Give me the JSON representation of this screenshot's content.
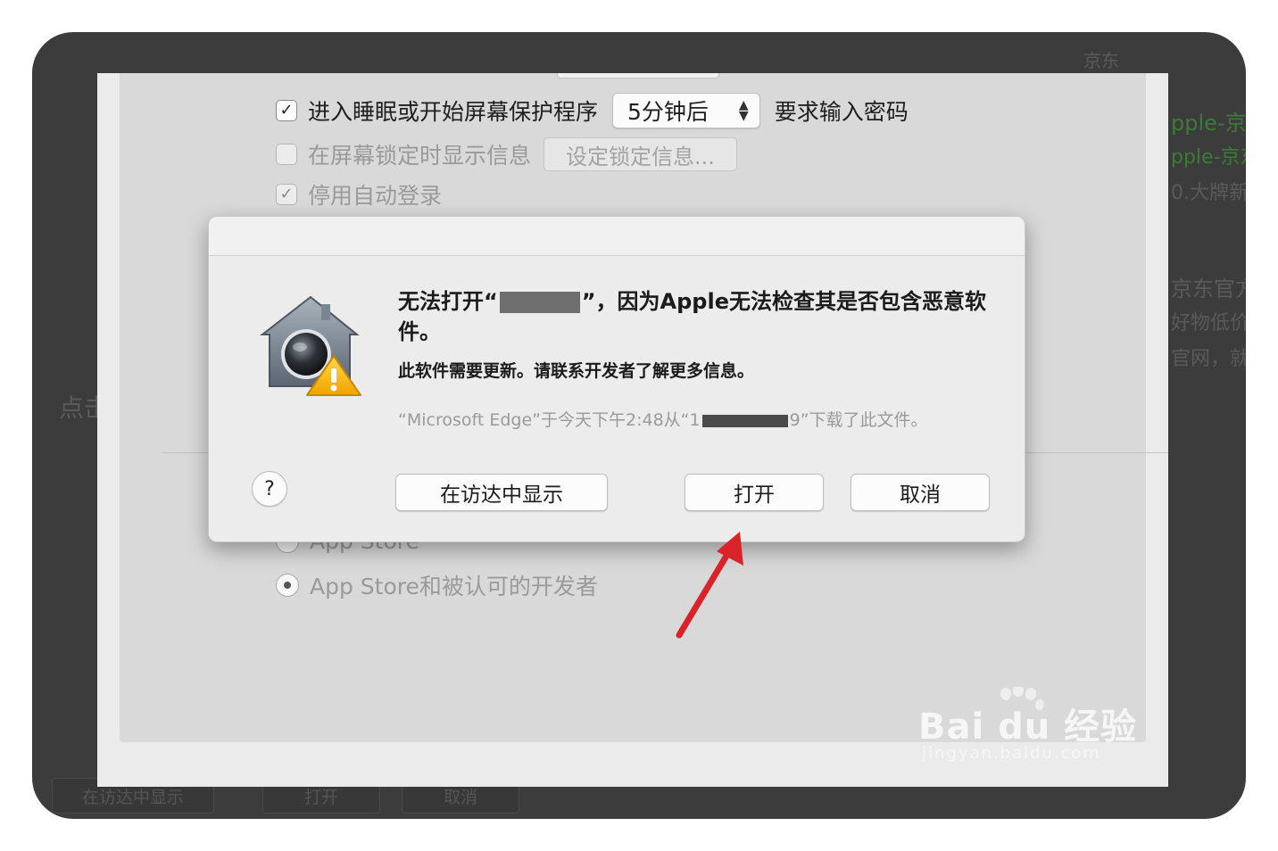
{
  "background": {
    "top_right": "京东",
    "right_lines": [
      "pple-京",
      "pple-京东",
      "0.大牌新",
      "京东官方",
      "好物低价",
      "官网，就"
    ],
    "left_lines": [
      "点击"
    ],
    "bottom_buttons": [
      "在访达中显示",
      "打开",
      "取消"
    ]
  },
  "settings": {
    "require_password_label": "进入睡眠或开始屏幕保护程序",
    "require_password_delay": "5分钟后",
    "require_password_suffix": "要求输入密码",
    "show_message_label": "在屏幕锁定时显示信息",
    "set_lock_message_button": "设定锁定信息...",
    "disable_autologin_label": "停用自动登录",
    "app_store_option": "App Store",
    "app_store_identified_option": "App Store和被认可的开发者"
  },
  "dialog": {
    "heading_part1": "无法打开“",
    "heading_part2": "”，因为Apple无法检查其是否包含恶意软件。",
    "subtext": "此软件需要更新。请联系开发者了解更多信息。",
    "info_part1": "“Microsoft Edge”于今天下午2:48从“1",
    "info_part2": "9”下载了此文件。",
    "help_label": "?",
    "show_in_finder_button": "在访达中显示",
    "open_button": "打开",
    "cancel_button": "取消"
  },
  "watermark": {
    "brand": "Bai du 经验",
    "url": "jingyan.baidu.com"
  },
  "colors": {
    "arrow": "#d8232a",
    "frame": "#3c3c3c",
    "pane": "#d9d9d9"
  }
}
